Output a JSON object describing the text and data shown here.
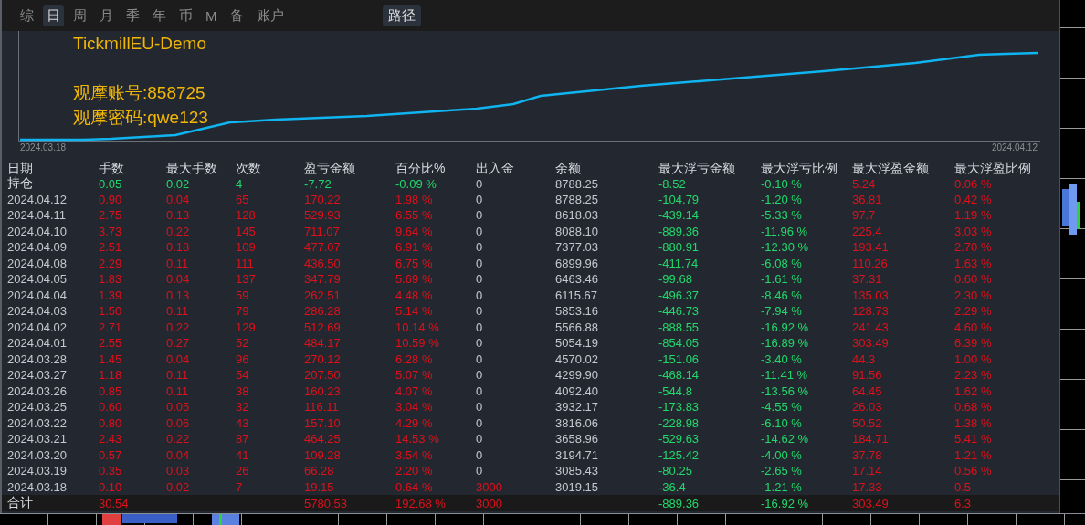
{
  "tabs": [
    {
      "label": "综",
      "selected": false
    },
    {
      "label": "日",
      "selected": true
    },
    {
      "label": "周",
      "selected": false
    },
    {
      "label": "月",
      "selected": false
    },
    {
      "label": "季",
      "selected": false
    },
    {
      "label": "年",
      "selected": false
    },
    {
      "label": "币",
      "selected": false
    },
    {
      "label": "M",
      "selected": false
    },
    {
      "label": "备",
      "selected": false
    },
    {
      "label": "账户",
      "selected": false
    }
  ],
  "path_button": {
    "label": "路径"
  },
  "chart": {
    "overlay": [
      "TickmillEU-Demo",
      "观摩账号:858725",
      "观摩密码:qwe123"
    ],
    "start_label": "2024.03.18",
    "end_label": "2024.04.12"
  },
  "table": {
    "columns": [
      "日期",
      "手数",
      "最大手数",
      "次数",
      "盈亏金额",
      "百分比%",
      "出入金",
      "余额",
      "最大浮亏金额",
      "最大浮亏比例",
      "最大浮盈金额",
      "最大浮盈比例"
    ],
    "rows": [
      {
        "kind": "position",
        "cells": [
          "持仓",
          "0.05",
          "0.02",
          "4",
          "-7.72",
          "-0.09 %",
          "0",
          "8788.25",
          "-8.52",
          "-0.10 %",
          "5.24",
          "0.06 %"
        ]
      },
      {
        "kind": "day",
        "cells": [
          "2024.04.12",
          "0.90",
          "0.04",
          "65",
          "170.22",
          "1.98 %",
          "0",
          "8788.25",
          "-104.79",
          "-1.20 %",
          "36.81",
          "0.42 %"
        ]
      },
      {
        "kind": "day",
        "cells": [
          "2024.04.11",
          "2.75",
          "0.13",
          "128",
          "529.93",
          "6.55 %",
          "0",
          "8618.03",
          "-439.14",
          "-5.33 %",
          "97.7",
          "1.19 %"
        ]
      },
      {
        "kind": "day",
        "cells": [
          "2024.04.10",
          "3.73",
          "0.22",
          "145",
          "711.07",
          "9.64 %",
          "0",
          "8088.10",
          "-889.36",
          "-11.96 %",
          "225.4",
          "3.03 %"
        ]
      },
      {
        "kind": "day",
        "cells": [
          "2024.04.09",
          "2.51",
          "0.18",
          "109",
          "477.07",
          "6.91 %",
          "0",
          "7377.03",
          "-880.91",
          "-12.30 %",
          "193.41",
          "2.70 %"
        ]
      },
      {
        "kind": "day",
        "cells": [
          "2024.04.08",
          "2.29",
          "0.11",
          "111",
          "436.50",
          "6.75 %",
          "0",
          "6899.96",
          "-411.74",
          "-6.08 %",
          "110.26",
          "1.63 %"
        ]
      },
      {
        "kind": "day",
        "cells": [
          "2024.04.05",
          "1.83",
          "0.04",
          "137",
          "347.79",
          "5.69 %",
          "0",
          "6463.46",
          "-99.68",
          "-1.61 %",
          "37.31",
          "0.60 %"
        ]
      },
      {
        "kind": "day",
        "cells": [
          "2024.04.04",
          "1.39",
          "0.13",
          "59",
          "262.51",
          "4.48 %",
          "0",
          "6115.67",
          "-496.37",
          "-8.46 %",
          "135.03",
          "2.30 %"
        ]
      },
      {
        "kind": "day",
        "cells": [
          "2024.04.03",
          "1.50",
          "0.11",
          "79",
          "286.28",
          "5.14 %",
          "0",
          "5853.16",
          "-446.73",
          "-7.94 %",
          "128.73",
          "2.29 %"
        ]
      },
      {
        "kind": "day",
        "cells": [
          "2024.04.02",
          "2.71",
          "0.22",
          "129",
          "512.69",
          "10.14 %",
          "0",
          "5566.88",
          "-888.55",
          "-16.92 %",
          "241.43",
          "4.60 %"
        ]
      },
      {
        "kind": "day",
        "cells": [
          "2024.04.01",
          "2.55",
          "0.27",
          "52",
          "484.17",
          "10.59 %",
          "0",
          "5054.19",
          "-854.05",
          "-16.89 %",
          "303.49",
          "6.39 %"
        ]
      },
      {
        "kind": "day",
        "cells": [
          "2024.03.28",
          "1.45",
          "0.04",
          "96",
          "270.12",
          "6.28 %",
          "0",
          "4570.02",
          "-151.06",
          "-3.40 %",
          "44.3",
          "1.00 %"
        ]
      },
      {
        "kind": "day",
        "cells": [
          "2024.03.27",
          "1.18",
          "0.11",
          "54",
          "207.50",
          "5.07 %",
          "0",
          "4299.90",
          "-468.14",
          "-11.41 %",
          "91.56",
          "2.23 %"
        ]
      },
      {
        "kind": "day",
        "cells": [
          "2024.03.26",
          "0.85",
          "0.11",
          "38",
          "160.23",
          "4.07 %",
          "0",
          "4092.40",
          "-544.8",
          "-13.56 %",
          "64.45",
          "1.62 %"
        ]
      },
      {
        "kind": "day",
        "cells": [
          "2024.03.25",
          "0.60",
          "0.05",
          "32",
          "116.11",
          "3.04 %",
          "0",
          "3932.17",
          "-173.83",
          "-4.55 %",
          "26.03",
          "0.68 %"
        ]
      },
      {
        "kind": "day",
        "cells": [
          "2024.03.22",
          "0.80",
          "0.06",
          "43",
          "157.10",
          "4.29 %",
          "0",
          "3816.06",
          "-228.98",
          "-6.10 %",
          "50.52",
          "1.38 %"
        ]
      },
      {
        "kind": "day",
        "cells": [
          "2024.03.21",
          "2.43",
          "0.22",
          "87",
          "464.25",
          "14.53 %",
          "0",
          "3658.96",
          "-529.63",
          "-14.62 %",
          "184.71",
          "5.41 %"
        ]
      },
      {
        "kind": "day",
        "cells": [
          "2024.03.20",
          "0.57",
          "0.04",
          "41",
          "109.28",
          "3.54 %",
          "0",
          "3194.71",
          "-125.42",
          "-4.00 %",
          "37.78",
          "1.21 %"
        ]
      },
      {
        "kind": "day",
        "cells": [
          "2024.03.19",
          "0.35",
          "0.03",
          "26",
          "66.28",
          "2.20 %",
          "0",
          "3085.43",
          "-80.25",
          "-2.65 %",
          "17.14",
          "0.56 %"
        ]
      },
      {
        "kind": "day",
        "cells": [
          "2024.03.18",
          "0.10",
          "0.02",
          "7",
          "19.15",
          "0.64 %",
          "3000",
          "3019.15",
          "-36.4",
          "-1.21 %",
          "17.33",
          "0.5"
        ]
      },
      {
        "kind": "total",
        "cells": [
          "合计",
          "30.54",
          null,
          null,
          "5780.53",
          "192.68 %",
          "3000",
          null,
          "-889.36",
          "-16.92 %",
          "303.49",
          "6.3"
        ]
      }
    ]
  }
}
